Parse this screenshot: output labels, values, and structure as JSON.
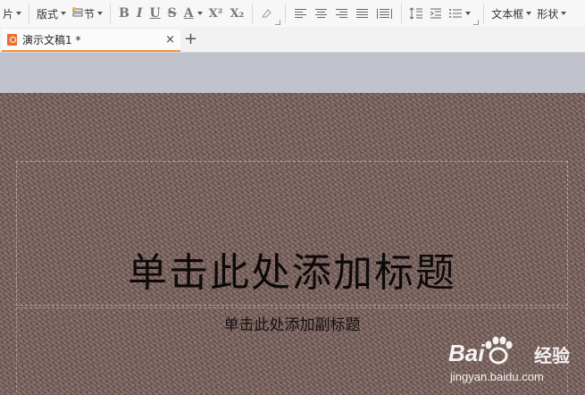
{
  "toolbar": {
    "cut_label": "片",
    "layout_label": "版式",
    "section_label": "节",
    "bold": "B",
    "italic": "I",
    "underline": "U",
    "strike": "S",
    "font_color": "A",
    "superscript": "X²",
    "subscript": "X₂",
    "textbox_label": "文本框",
    "shape_label": "形状"
  },
  "tab": {
    "title": "演示文稿1 *",
    "close": "×",
    "new": "+"
  },
  "slide": {
    "title_placeholder": "单击此处添加标题",
    "subtitle_placeholder": "单击此处添加副标题"
  },
  "watermark": {
    "brand": "Bai",
    "service": "经验",
    "url": "jingyan.baidu.com"
  }
}
